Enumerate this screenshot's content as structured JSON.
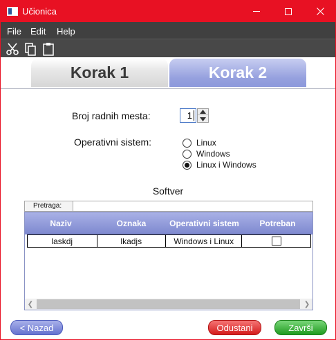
{
  "window": {
    "title": "Učionica",
    "accent_color": "#e81123",
    "minimize_icon": "minimize-icon",
    "maximize_icon": "maximize-icon",
    "close_icon": "close-icon"
  },
  "menu": {
    "items": [
      "File",
      "Edit",
      "Help"
    ]
  },
  "toolbar": {
    "icons": [
      "cut-icon",
      "copy-icon",
      "paste-icon"
    ]
  },
  "tabs": [
    {
      "label": "Korak 1",
      "active": false
    },
    {
      "label": "Korak 2",
      "active": true
    }
  ],
  "form": {
    "broj_label": "Broj radnih mesta:",
    "broj_value": "1",
    "os_label": "Operativni sistem:",
    "os_options": [
      {
        "label": "Linux",
        "checked": false
      },
      {
        "label": "Windows",
        "checked": false
      },
      {
        "label": "Linux i Windows",
        "checked": true
      }
    ]
  },
  "software": {
    "title": "Softver",
    "search_label": "Pretraga:",
    "search_value": "",
    "columns": [
      "Naziv",
      "Oznaka",
      "Operativni sistem",
      "Potreban"
    ],
    "rows": [
      {
        "naziv": "laskdj",
        "oznaka": "lkadjs",
        "os": "Windows i Linux",
        "potreban": false
      }
    ],
    "header_color": "#8c96d6"
  },
  "buttons": {
    "back": "< Nazad",
    "cancel": "Odustani",
    "finish": "Završi"
  }
}
